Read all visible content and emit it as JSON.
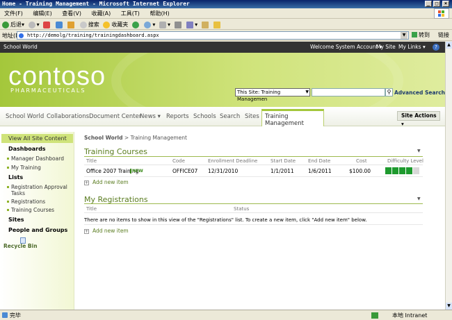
{
  "window": {
    "title": "Home - Training Management - Microsoft Internet Explorer",
    "minimize": "_",
    "maximize": "□",
    "close": "×"
  },
  "menubar": [
    "文件(F)",
    "编辑(E)",
    "查看(V)",
    "收藏(A)",
    "工具(T)",
    "帮助(H)"
  ],
  "toolbar": {
    "back": "后退",
    "search": "搜索",
    "favorites": "收藏夹"
  },
  "addressbar": {
    "label": "地址(D)",
    "url": "http://demolg/training/trainingdashboard.aspx",
    "go": "转到",
    "links": "链接"
  },
  "sp_topbar": {
    "site": "School World",
    "welcome": "Welcome System Account",
    "my_site": "My Site",
    "my_links": "My Links",
    "help": "?"
  },
  "banner": {
    "logo_text": "contoso",
    "logo_sub": "PHARMACEUTICALS",
    "scope": "This Site: Training Managemen",
    "advanced_search": "Advanced Search"
  },
  "nav": {
    "tabs": [
      "School World",
      "Collaborations",
      "Document Center",
      "News",
      "Reports",
      "Schools",
      "Search",
      "Sites"
    ],
    "active": "Training Management",
    "site_actions": "Site Actions"
  },
  "leftnav": {
    "view_all": "View All Site Content",
    "dashboards_head": "Dashboards",
    "dashboards": [
      "Manager Dashboard",
      "My Training"
    ],
    "lists_head": "Lists",
    "lists": [
      "Registration Approval Tasks",
      "Registrations",
      "Training Courses"
    ],
    "sites_head": "Sites",
    "people_head": "People and Groups",
    "recycle_bin": "Recycle Bin"
  },
  "breadcrumb": {
    "root": "School World",
    "sep": ">",
    "current": "Training Management"
  },
  "courses": {
    "title": "Training Courses",
    "columns": [
      "Title",
      "Code",
      "Enrollment Deadline",
      "Start Date",
      "End Date",
      "Cost",
      "Difficulty Level"
    ],
    "rows": [
      {
        "title": "Office 2007 Training",
        "new_badge": "NEW",
        "code": "OFFICE07",
        "deadline": "12/31/2010",
        "start": "1/1/2011",
        "end": "1/6/2011",
        "cost": "$100.00",
        "difficulty_filled": 4,
        "difficulty_total": 5
      }
    ],
    "add_new": "Add new item"
  },
  "registrations": {
    "title": "My Registrations",
    "columns": [
      "Title",
      "Status"
    ],
    "empty_message": "There are no items to show in this view of the \"Registrations\" list. To create a new item, click \"Add new item\" below.",
    "add_new": "Add new item"
  },
  "statusbar": {
    "left": "完毕",
    "zone": "本地 Intranet"
  },
  "colors": {
    "accent": "#a4c73b",
    "difficulty_on": "#1e9a2e",
    "difficulty_off": "#d8d8d8",
    "title_green": "#5a7c20"
  }
}
